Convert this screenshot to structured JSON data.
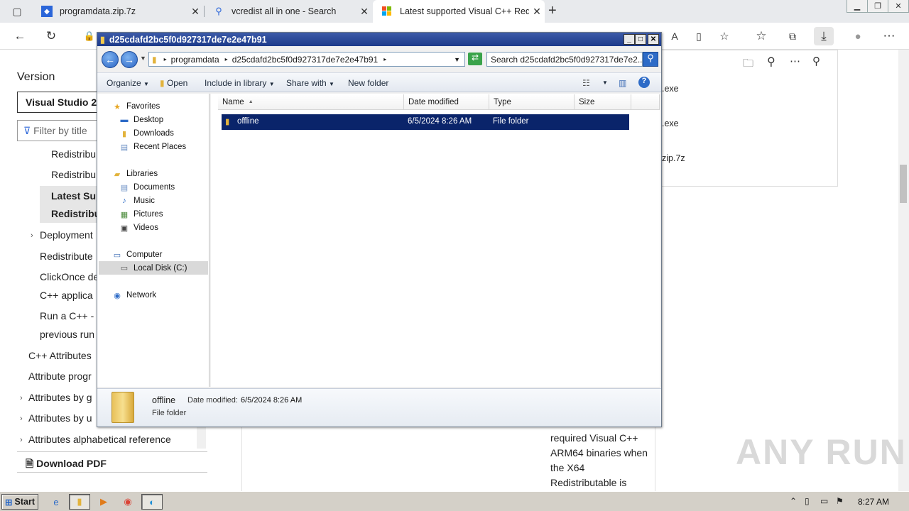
{
  "browser": {
    "tabs": [
      {
        "title": "programdata.zip.7z",
        "icon": "dropbox-icon"
      },
      {
        "title": "vcredist all in one - Search",
        "icon": "search-icon"
      },
      {
        "title": "Latest supported Visual C++ Red",
        "icon": "microsoft-icon"
      }
    ],
    "new_tab": "+"
  },
  "downloads": {
    "items": [
      ".exe",
      ".exe",
      "zip.7z"
    ]
  },
  "docnav": {
    "heading": "Version",
    "version_select": "Visual Studio 20",
    "filter_placeholder": "Filter by title",
    "items": [
      "Redistribu",
      "Redistribu",
      "Latest Sup",
      "Redistribu",
      "Deployment",
      "Redistribute",
      "ClickOnce de",
      "C++ applica",
      "Run a C++ -",
      "previous run",
      "C++ Attributes",
      "Attribute progr",
      "Attributes by g",
      "Attributes by u",
      "Attributes alphabetical reference"
    ],
    "download_pdf": "Download PDF"
  },
  "explorer": {
    "title": "d25cdafd2bc5f0d927317de7e2e47b91",
    "breadcrumb": [
      "programdata",
      "d25cdafd2bc5f0d927317de7e2e47b91"
    ],
    "search_placeholder": "Search d25cdafd2bc5f0d927317de7e2...",
    "commands": {
      "organize": "Organize",
      "open": "Open",
      "include": "Include in library",
      "share": "Share with",
      "new_folder": "New folder"
    },
    "nav": {
      "favorites": "Favorites",
      "desktop": "Desktop",
      "downloads": "Downloads",
      "recent": "Recent Places",
      "libraries": "Libraries",
      "documents": "Documents",
      "music": "Music",
      "pictures": "Pictures",
      "videos": "Videos",
      "computer": "Computer",
      "local_disk": "Local Disk (C:)",
      "network": "Network"
    },
    "columns": {
      "name": "Name",
      "date": "Date modified",
      "type": "Type",
      "size": "Size"
    },
    "files": [
      {
        "name": "offline",
        "date": "6/5/2024 8:26 AM",
        "type": "File folder",
        "size": ""
      }
    ],
    "details": {
      "name": "offline",
      "date_label": "Date modified:",
      "date": "6/5/2024 8:26 AM",
      "type": "File folder"
    }
  },
  "content": {
    "lines": [
      "required Visual C++",
      "ARM64 binaries when",
      "the X64",
      "Redistributable is"
    ]
  },
  "watermark": "ANY RUN",
  "taskbar": {
    "start": "Start",
    "clock": "8:27 AM"
  }
}
